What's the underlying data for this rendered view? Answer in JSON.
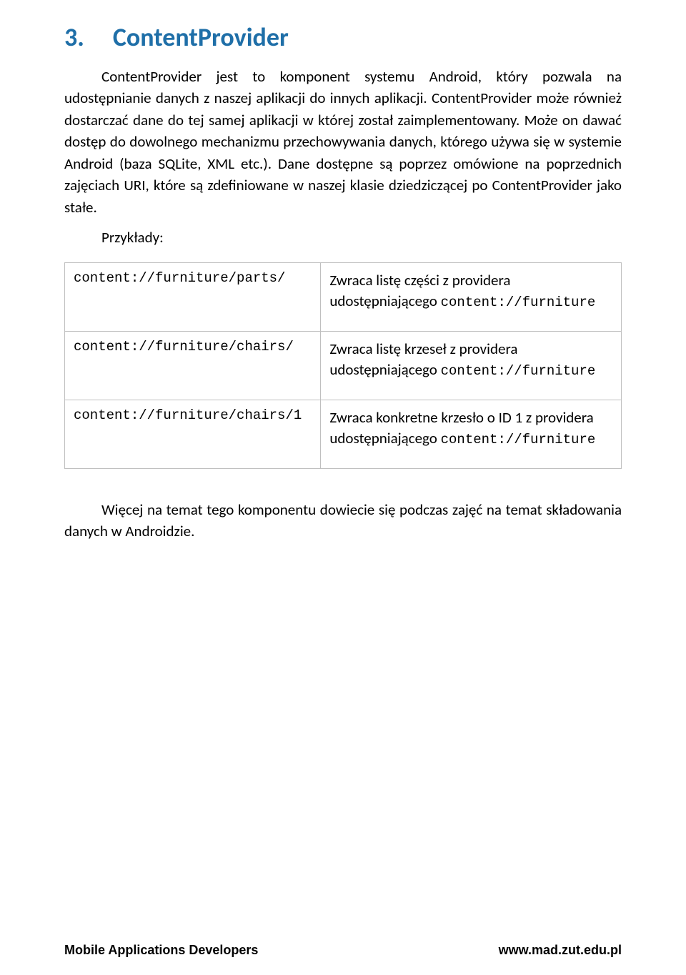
{
  "heading": {
    "number": "3.",
    "title": "ContentProvider"
  },
  "paragraphs": {
    "p1": "ContentProvider jest to komponent systemu Android, który pozwala na udostępnianie danych z naszej aplikacji do innych aplikacji. ContentProvider może również dostarczać dane do tej samej aplikacji w której został zaimplementowany. Może on dawać dostęp do dowolnego mechanizmu przechowywania danych, którego używa się w systemie Android (baza SQLite, XML etc.). Dane dostępne są poprzez omówione na poprzednich zajęciach URI, które są zdefiniowane w naszej klasie dziedziczącej po ContentProvider jako stałe.",
    "examples_label": "Przykłady:",
    "p2": "Więcej na temat tego komponentu dowiecie się podczas zajęć na temat składowania danych w Androidzie."
  },
  "table": {
    "rows": [
      {
        "code": "content://furniture/parts/",
        "desc_a": "Zwraca listę części z providera udostępniającego ",
        "desc_mono": "content://furniture"
      },
      {
        "code": "content://furniture/chairs/",
        "desc_a": "Zwraca listę krzeseł z providera udostępniającego  ",
        "desc_mono": "content://furniture"
      },
      {
        "code": "content://furniture/chairs/1",
        "desc_a": "Zwraca konkretne krzesło o ID 1 z providera udostępniającego ",
        "desc_mono": "content://furniture"
      }
    ]
  },
  "footer": {
    "left": "Mobile Applications Developers",
    "right": "www.mad.zut.edu.pl"
  }
}
